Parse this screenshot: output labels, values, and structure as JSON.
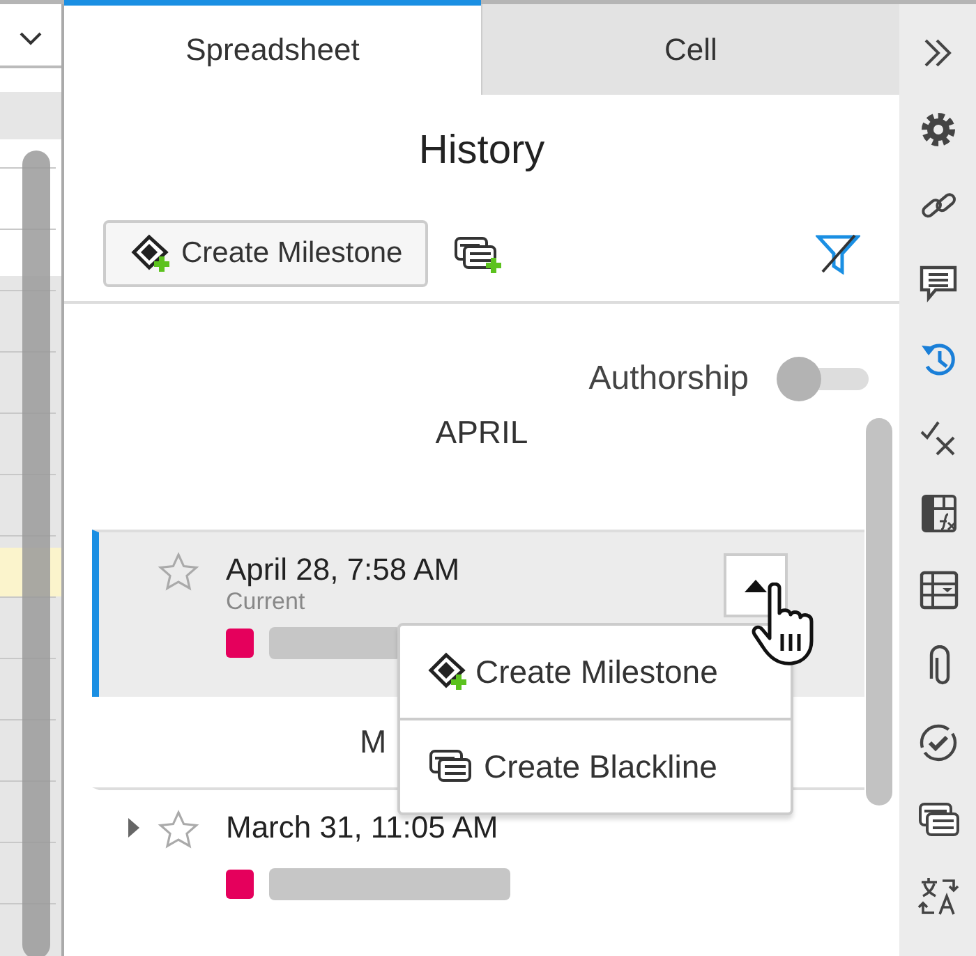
{
  "tabs": [
    {
      "label": "Spreadsheet",
      "selected": true
    },
    {
      "label": "Cell",
      "selected": false
    }
  ],
  "title": "History",
  "toolbar": {
    "milestone_button": "Create Milestone"
  },
  "authorship": {
    "label": "Authorship",
    "on": false
  },
  "sections": [
    {
      "heading": "APRIL",
      "entries": [
        {
          "date": "April 28, 7:58 AM",
          "status": "Current",
          "starred": false,
          "selected": true,
          "expandable": false,
          "color": "#e5005c",
          "menu": [
            {
              "kind": "milestone",
              "label": "Create Milestone"
            },
            {
              "kind": "blackline",
              "label": "Create Blackline"
            }
          ]
        }
      ]
    },
    {
      "heading": "M",
      "entries": [
        {
          "date": "March 31, 11:05 AM",
          "starred": false,
          "selected": false,
          "expandable": true,
          "color": "#e5005c"
        }
      ]
    }
  ],
  "side_icons": [
    {
      "kind": "collapse",
      "selected": false
    },
    {
      "kind": "settings",
      "selected": false
    },
    {
      "kind": "link",
      "selected": false
    },
    {
      "kind": "comments",
      "selected": false
    },
    {
      "kind": "history",
      "selected": true
    },
    {
      "kind": "review",
      "selected": false
    },
    {
      "kind": "formula",
      "selected": false
    },
    {
      "kind": "table",
      "selected": false
    },
    {
      "kind": "attachment",
      "selected": false
    },
    {
      "kind": "approval",
      "selected": false
    },
    {
      "kind": "blackline",
      "selected": false
    },
    {
      "kind": "translate",
      "selected": false
    }
  ]
}
